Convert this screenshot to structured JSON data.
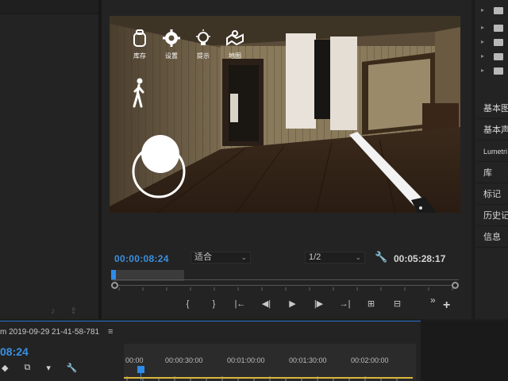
{
  "video_overlay": {
    "buttons": [
      {
        "label": "库存",
        "icon": "backpack-icon"
      },
      {
        "label": "设置",
        "icon": "gear-icon"
      },
      {
        "label": "提示",
        "icon": "lightbulb-icon"
      },
      {
        "label": "地图",
        "icon": "map-icon"
      }
    ]
  },
  "program_monitor": {
    "current_timecode": "00:00:08:24",
    "zoom_value": "适合",
    "resolution_value": "1/2",
    "duration_timecode": "00:05:28:17"
  },
  "right_panel": {
    "items": [
      "基本图",
      "基本声",
      "Lumetri",
      "库",
      "标记",
      "历史记",
      "信息"
    ]
  },
  "timeline": {
    "tab_title": "m 2019-09-29 21-41-58-781",
    "menu_glyph": "≡",
    "timecode": "08:24",
    "ruler_labels": [
      "00:00",
      "00:00:30:00",
      "00:01:00:00",
      "00:01:30:00",
      "00:02:00:00"
    ],
    "playhead_fraction": 0.02
  },
  "transport": {
    "more_glyph": "»",
    "add_glyph": "+"
  },
  "colors": {
    "accent_blue": "#3b8fe0",
    "work_area_yellow": "#d9b63b",
    "panel_bg": "#232323"
  }
}
